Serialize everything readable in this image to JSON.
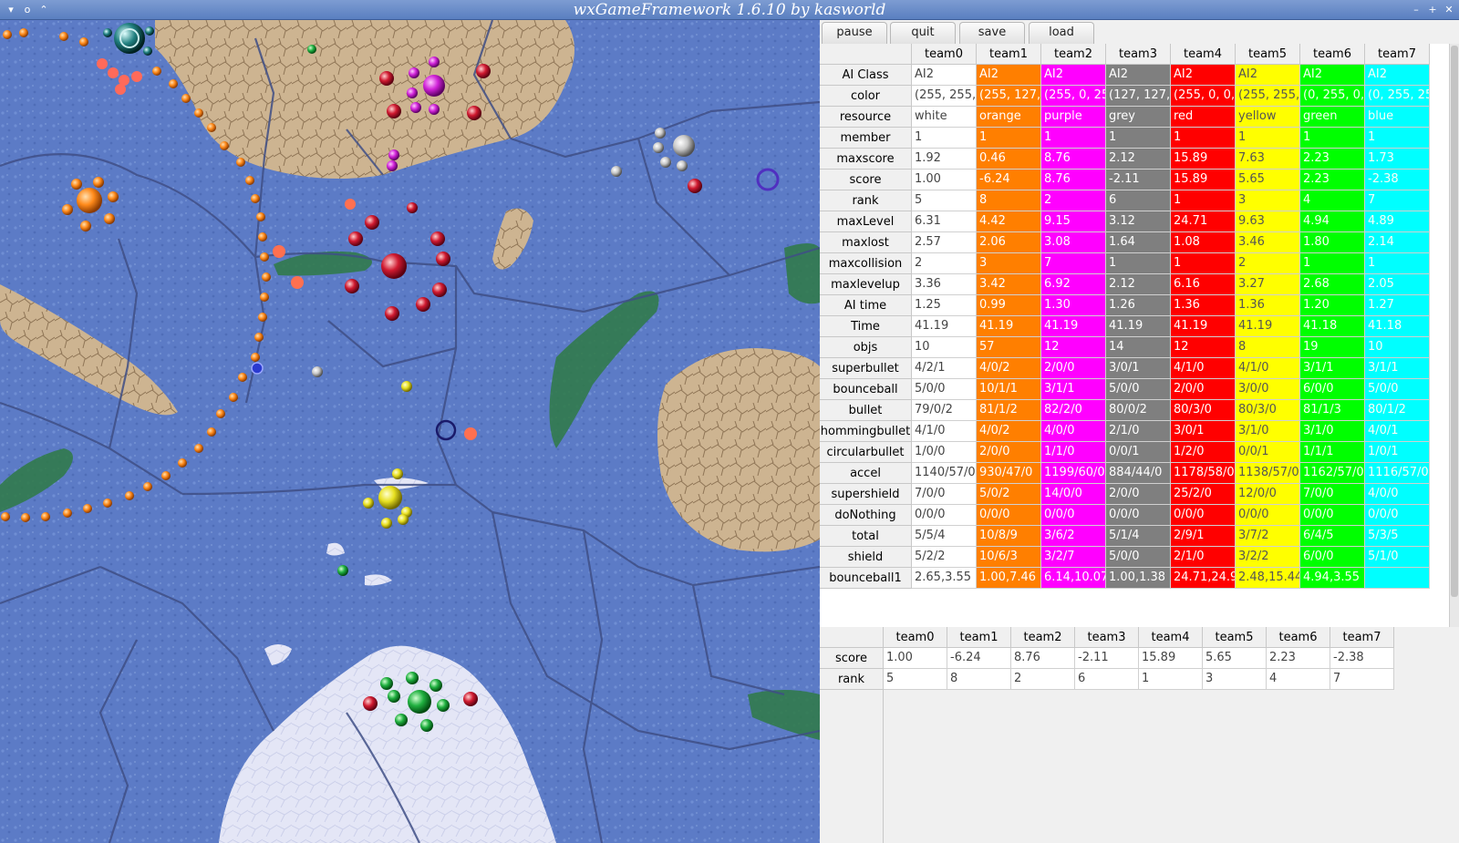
{
  "window": {
    "title": "wxGameFramework 1.6.10 by kasworld",
    "left_icons": [
      "▾",
      "o",
      "⌃"
    ],
    "right_icons": [
      "–",
      "+",
      "✕"
    ]
  },
  "toolbar": {
    "pause_label": "pause",
    "quit_label": "quit",
    "save_label": "save",
    "load_label": "load"
  },
  "stats_table": {
    "columns": [
      "team0",
      "team1",
      "team2",
      "team3",
      "team4",
      "team5",
      "team6",
      "team7"
    ],
    "column_colors": [
      "#ffffff",
      "#ff7f00",
      "#ff00ff",
      "#7f7f7f",
      "#ff0000",
      "#ffff00",
      "#00ff00",
      "#00ffff"
    ],
    "rows": [
      {
        "label": "AI Class",
        "cells": [
          "AI2",
          "AI2",
          "AI2",
          "AI2",
          "AI2",
          "AI2",
          "AI2",
          "AI2"
        ]
      },
      {
        "label": "color",
        "cells": [
          "(255, 255,",
          "(255, 127,",
          "(255, 0, 25",
          "(127, 127,",
          "(255, 0, 0,",
          "(255, 255,",
          "(0, 255, 0,",
          "(0, 255, 25"
        ]
      },
      {
        "label": "resource",
        "cells": [
          "white",
          "orange",
          "purple",
          "grey",
          "red",
          "yellow",
          "green",
          "blue"
        ]
      },
      {
        "label": "member",
        "cells": [
          "1",
          "1",
          "1",
          "1",
          "1",
          "1",
          "1",
          "1"
        ]
      },
      {
        "label": "maxscore",
        "cells": [
          "1.92",
          "0.46",
          "8.76",
          "2.12",
          "15.89",
          "7.63",
          "2.23",
          "1.73"
        ]
      },
      {
        "label": "score",
        "cells": [
          "1.00",
          "-6.24",
          "8.76",
          "-2.11",
          "15.89",
          "5.65",
          "2.23",
          "-2.38"
        ]
      },
      {
        "label": "rank",
        "cells": [
          "5",
          "8",
          "2",
          "6",
          "1",
          "3",
          "4",
          "7"
        ]
      },
      {
        "label": "maxLevel",
        "cells": [
          "6.31",
          "4.42",
          "9.15",
          "3.12",
          "24.71",
          "9.63",
          "4.94",
          "4.89"
        ]
      },
      {
        "label": "maxlost",
        "cells": [
          "2.57",
          "2.06",
          "3.08",
          "1.64",
          "1.08",
          "3.46",
          "1.80",
          "2.14"
        ]
      },
      {
        "label": "maxcollision",
        "cells": [
          "2",
          "3",
          "7",
          "1",
          "1",
          "2",
          "1",
          "1"
        ]
      },
      {
        "label": "maxlevelup",
        "cells": [
          "3.36",
          "3.42",
          "6.92",
          "2.12",
          "6.16",
          "3.27",
          "2.68",
          "2.05"
        ]
      },
      {
        "label": "AI time",
        "cells": [
          "1.25",
          "0.99",
          "1.30",
          "1.26",
          "1.36",
          "1.36",
          "1.20",
          "1.27"
        ]
      },
      {
        "label": "Time",
        "cells": [
          "41.19",
          "41.19",
          "41.19",
          "41.19",
          "41.19",
          "41.19",
          "41.18",
          "41.18"
        ]
      },
      {
        "label": "objs",
        "cells": [
          "10",
          "57",
          "12",
          "14",
          "12",
          "8",
          "19",
          "10"
        ]
      },
      {
        "label": "superbullet",
        "cells": [
          "4/2/1",
          "4/0/2",
          "2/0/0",
          "3/0/1",
          "4/1/0",
          "4/1/0",
          "3/1/1",
          "3/1/1"
        ]
      },
      {
        "label": "bounceball",
        "cells": [
          "5/0/0",
          "10/1/1",
          "3/1/1",
          "5/0/0",
          "2/0/0",
          "3/0/0",
          "6/0/0",
          "5/0/0"
        ]
      },
      {
        "label": "bullet",
        "cells": [
          "79/0/2",
          "81/1/2",
          "82/2/0",
          "80/0/2",
          "80/3/0",
          "80/3/0",
          "81/1/3",
          "80/1/2"
        ]
      },
      {
        "label": "hommingbullet",
        "cells": [
          "4/1/0",
          "4/0/2",
          "4/0/0",
          "2/1/0",
          "3/0/1",
          "3/1/0",
          "3/1/0",
          "4/0/1"
        ]
      },
      {
        "label": "circularbullet",
        "cells": [
          "1/0/0",
          "2/0/0",
          "1/1/0",
          "0/0/1",
          "1/2/0",
          "0/0/1",
          "1/1/1",
          "1/0/1"
        ]
      },
      {
        "label": "accel",
        "cells": [
          "1140/57/0",
          "930/47/0",
          "1199/60/0",
          "884/44/0",
          "1178/58/0",
          "1138/57/0",
          "1162/57/0",
          "1116/57/0"
        ]
      },
      {
        "label": "supershield",
        "cells": [
          "7/0/0",
          "5/0/2",
          "14/0/0",
          "2/0/0",
          "25/2/0",
          "12/0/0",
          "7/0/0",
          "4/0/0"
        ]
      },
      {
        "label": "doNothing",
        "cells": [
          "0/0/0",
          "0/0/0",
          "0/0/0",
          "0/0/0",
          "0/0/0",
          "0/0/0",
          "0/0/0",
          "0/0/0"
        ]
      },
      {
        "label": "total",
        "cells": [
          "5/5/4",
          "10/8/9",
          "3/6/2",
          "5/1/4",
          "2/9/1",
          "3/7/2",
          "6/4/5",
          "5/3/5"
        ]
      },
      {
        "label": "shield",
        "cells": [
          "5/2/2",
          "10/6/3",
          "3/2/7",
          "5/0/0",
          "2/1/0",
          "3/2/2",
          "6/0/0",
          "5/1/0"
        ]
      },
      {
        "label": "bounceball1",
        "cells": [
          "2.65,3.55",
          "1.00,7.46",
          "6.14,10.07",
          "1.00,1.38",
          "24.71,24.9",
          "2.48,15.44",
          "4.94,3.55",
          ""
        ]
      }
    ]
  },
  "summary_table": {
    "columns": [
      "team0",
      "team1",
      "team2",
      "team3",
      "team4",
      "team5",
      "team6",
      "team7"
    ],
    "rows": [
      {
        "label": "score",
        "cells": [
          "1.00",
          "-6.24",
          "8.76",
          "-2.11",
          "15.89",
          "5.65",
          "2.23",
          "-2.38"
        ]
      },
      {
        "label": "rank",
        "cells": [
          "5",
          "8",
          "2",
          "6",
          "1",
          "3",
          "4",
          "7"
        ]
      }
    ]
  }
}
